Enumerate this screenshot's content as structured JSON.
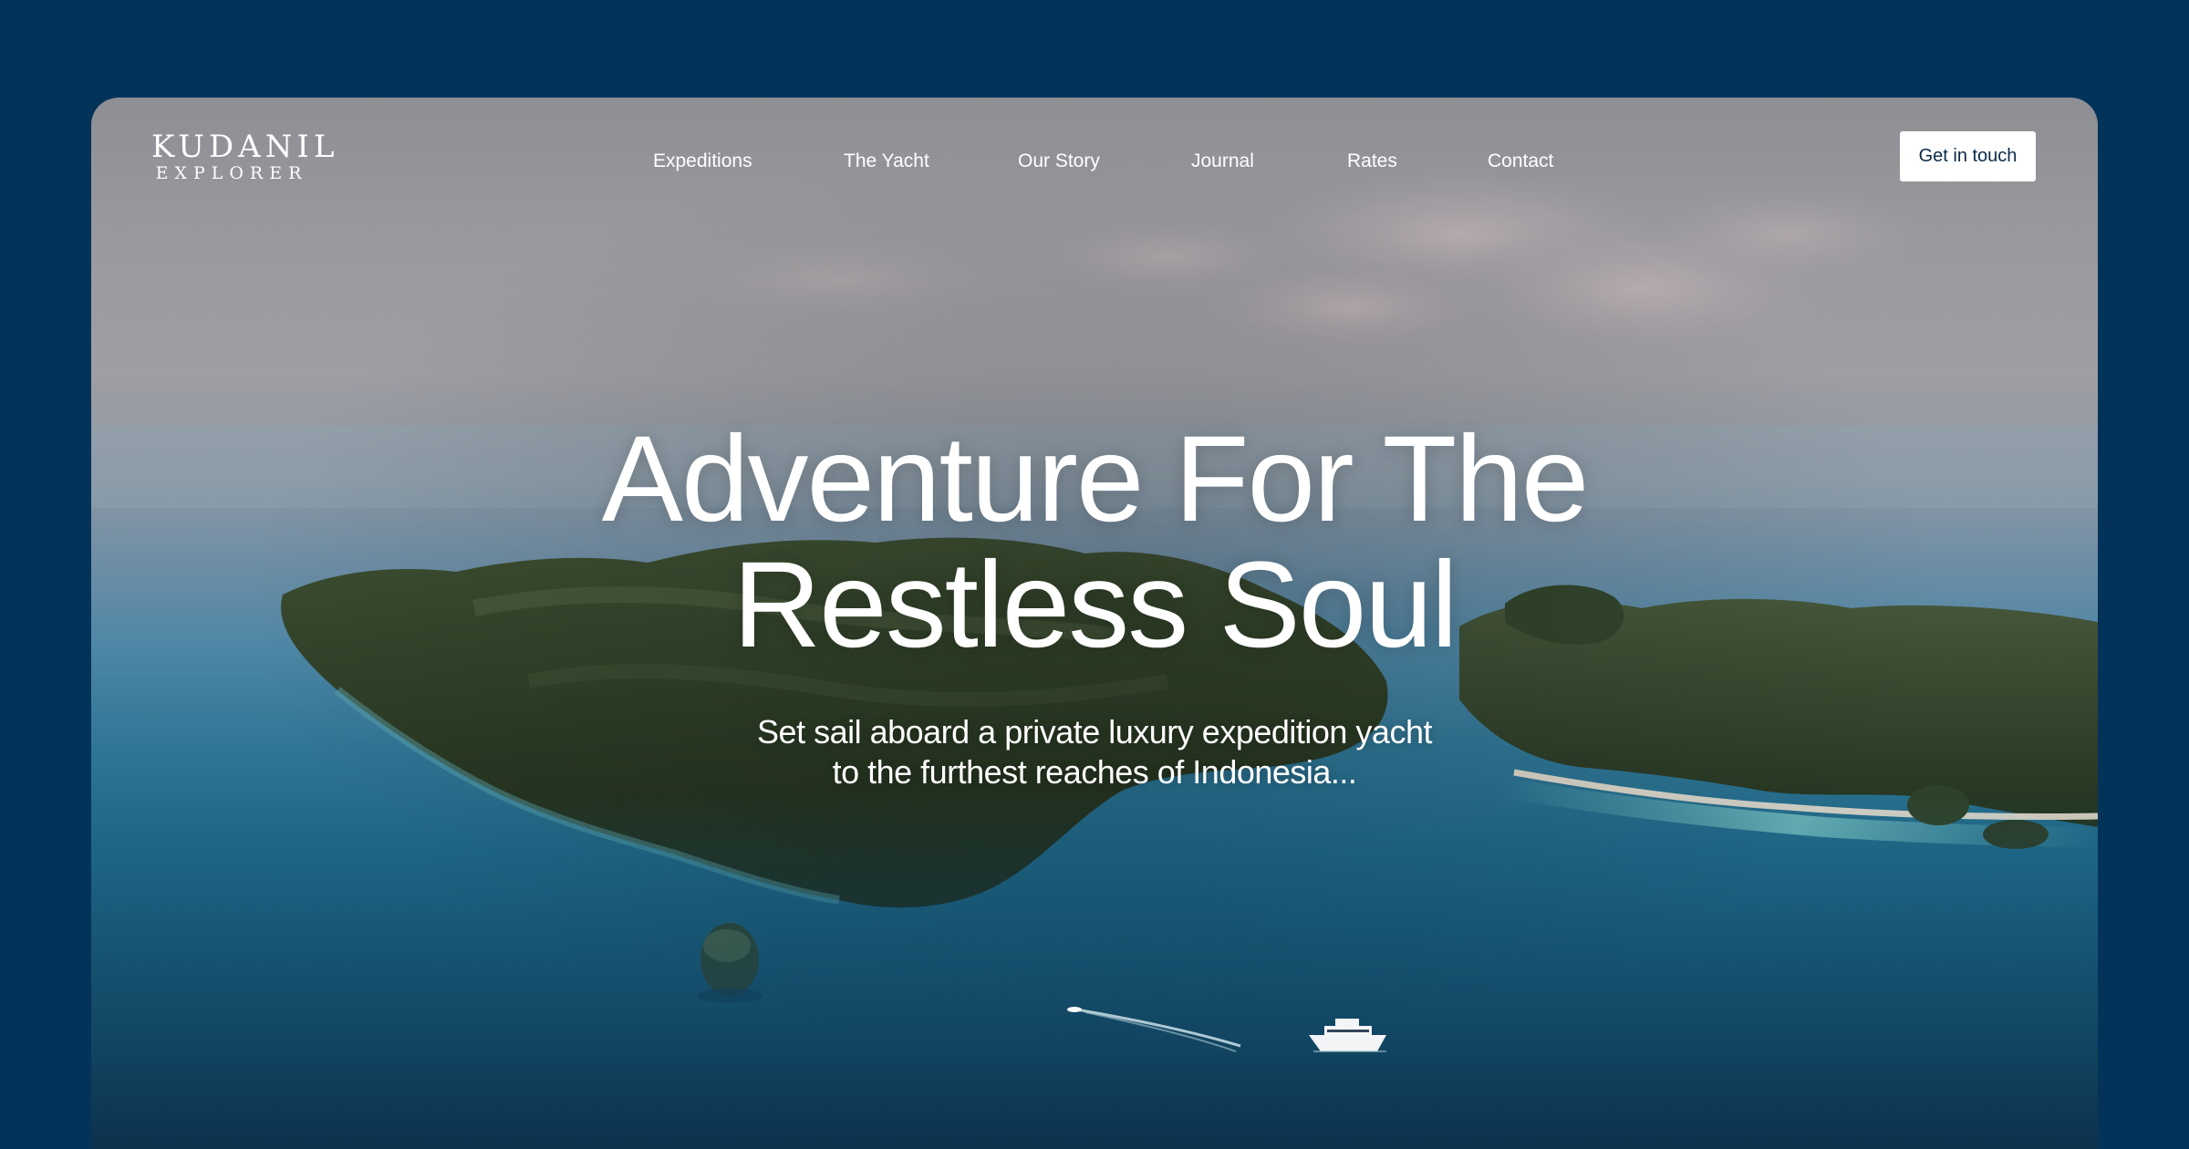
{
  "brand": {
    "name": "KUDANIL",
    "tagline": "EXPLORER"
  },
  "nav": {
    "items": [
      {
        "label": "Expeditions"
      },
      {
        "label": "The Yacht"
      },
      {
        "label": "Our Story"
      },
      {
        "label": "Journal"
      },
      {
        "label": "Rates"
      },
      {
        "label": "Contact"
      }
    ],
    "cta_label": "Get in touch"
  },
  "hero": {
    "headline_line1": "Adventure For The",
    "headline_line2": "Restless Soul",
    "subhead_line1": "Set sail aboard a private luxury expedition yacht",
    "subhead_line2": "to the furthest reaches of Indonesia..."
  },
  "colors": {
    "page_background": "#04335a",
    "cta_background": "#ffffff",
    "cta_text": "#0b2a47",
    "text": "#ffffff"
  }
}
